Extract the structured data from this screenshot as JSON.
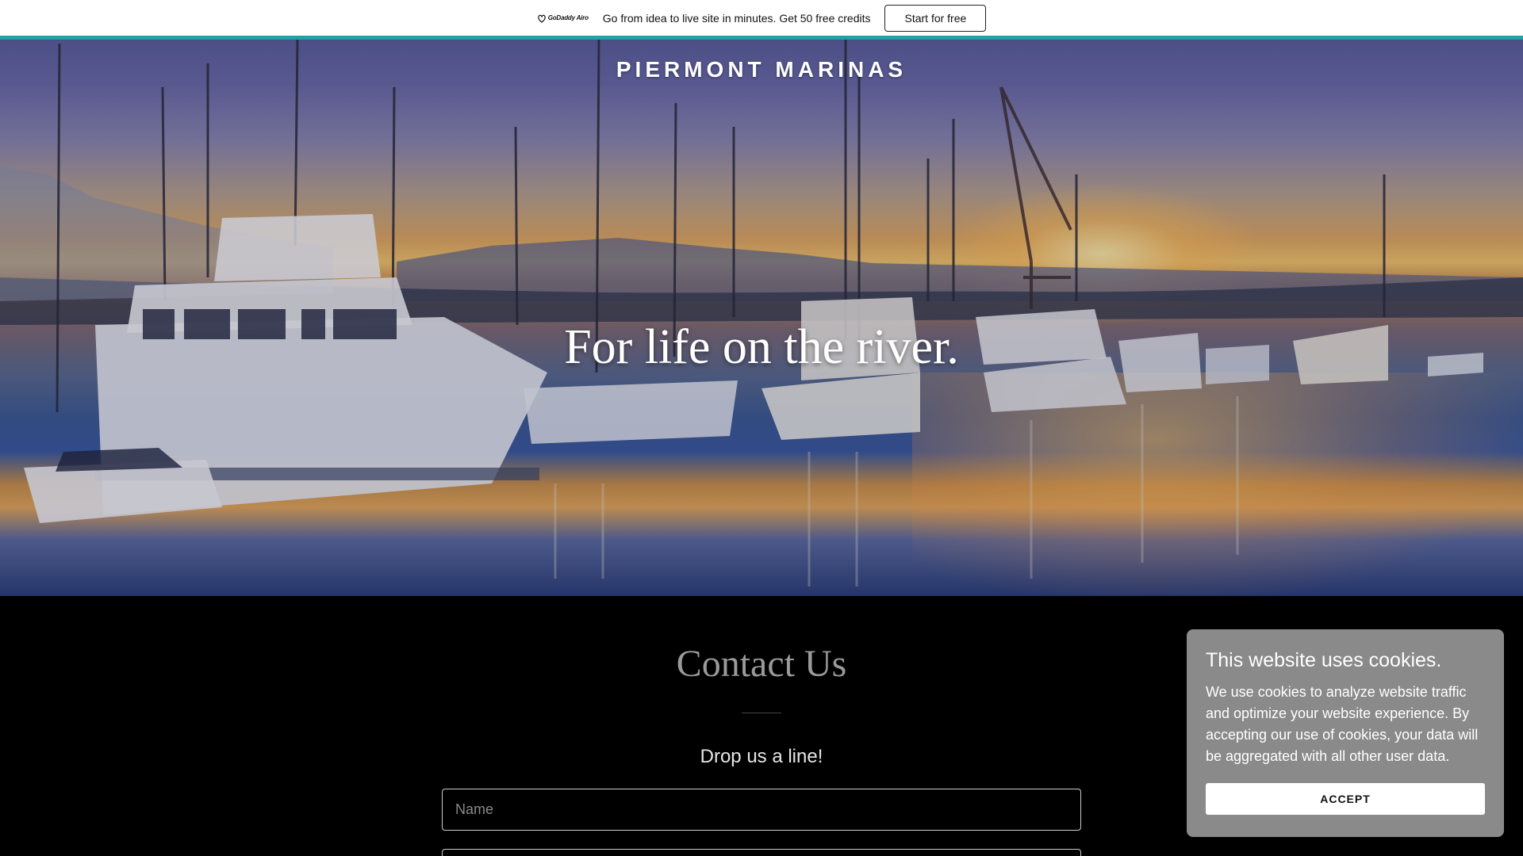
{
  "promo_bar": {
    "logo_text": "GoDaddy Airo",
    "message": "Go from idea to live site in minutes. Get 50 free credits",
    "cta_label": "Start for free"
  },
  "hero": {
    "site_title": "PIERMONT MARINAS",
    "tagline": "For life on the river."
  },
  "contact": {
    "heading": "Contact Us",
    "subheading": "Drop us a line!",
    "name_placeholder": "Name"
  },
  "cookie_banner": {
    "title": "This website uses cookies.",
    "body": "We use cookies to analyze website traffic and optimize your website experience. By accepting our use of cookies, your data will be aggregated with all other user data.",
    "accept_label": "ACCEPT"
  },
  "colors": {
    "accent_line": "#2a9ea6",
    "section_background": "#000000",
    "cookie_background": "#8a8a8a"
  }
}
